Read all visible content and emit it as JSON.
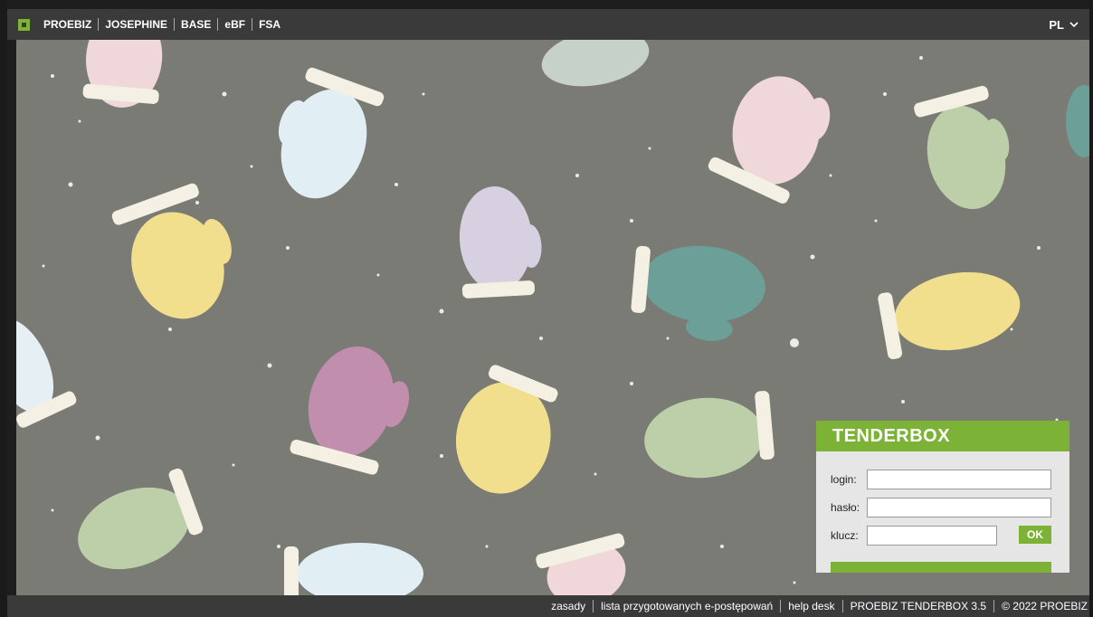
{
  "topbar": {
    "nav": [
      "PROEBIZ",
      "JOSEPHINE",
      "BASE",
      "eBF",
      "FSA"
    ],
    "language": "PL"
  },
  "login_box": {
    "title": "TENDERBOX",
    "login_label": "login:",
    "password_label": "hasło:",
    "key_label": "klucz:",
    "login_value": "",
    "password_value": "",
    "key_value": "",
    "ok_label": "OK"
  },
  "footer": {
    "links": [
      "zasady",
      "lista przygotowanych e-postępowań",
      "help desk",
      "PROEBIZ TENDERBOX 3.5",
      "© 2022 PROEBIZ"
    ]
  },
  "colors": {
    "accent": "#7cb236",
    "background": "#7a7b75",
    "bar": "#3a3a3a"
  }
}
